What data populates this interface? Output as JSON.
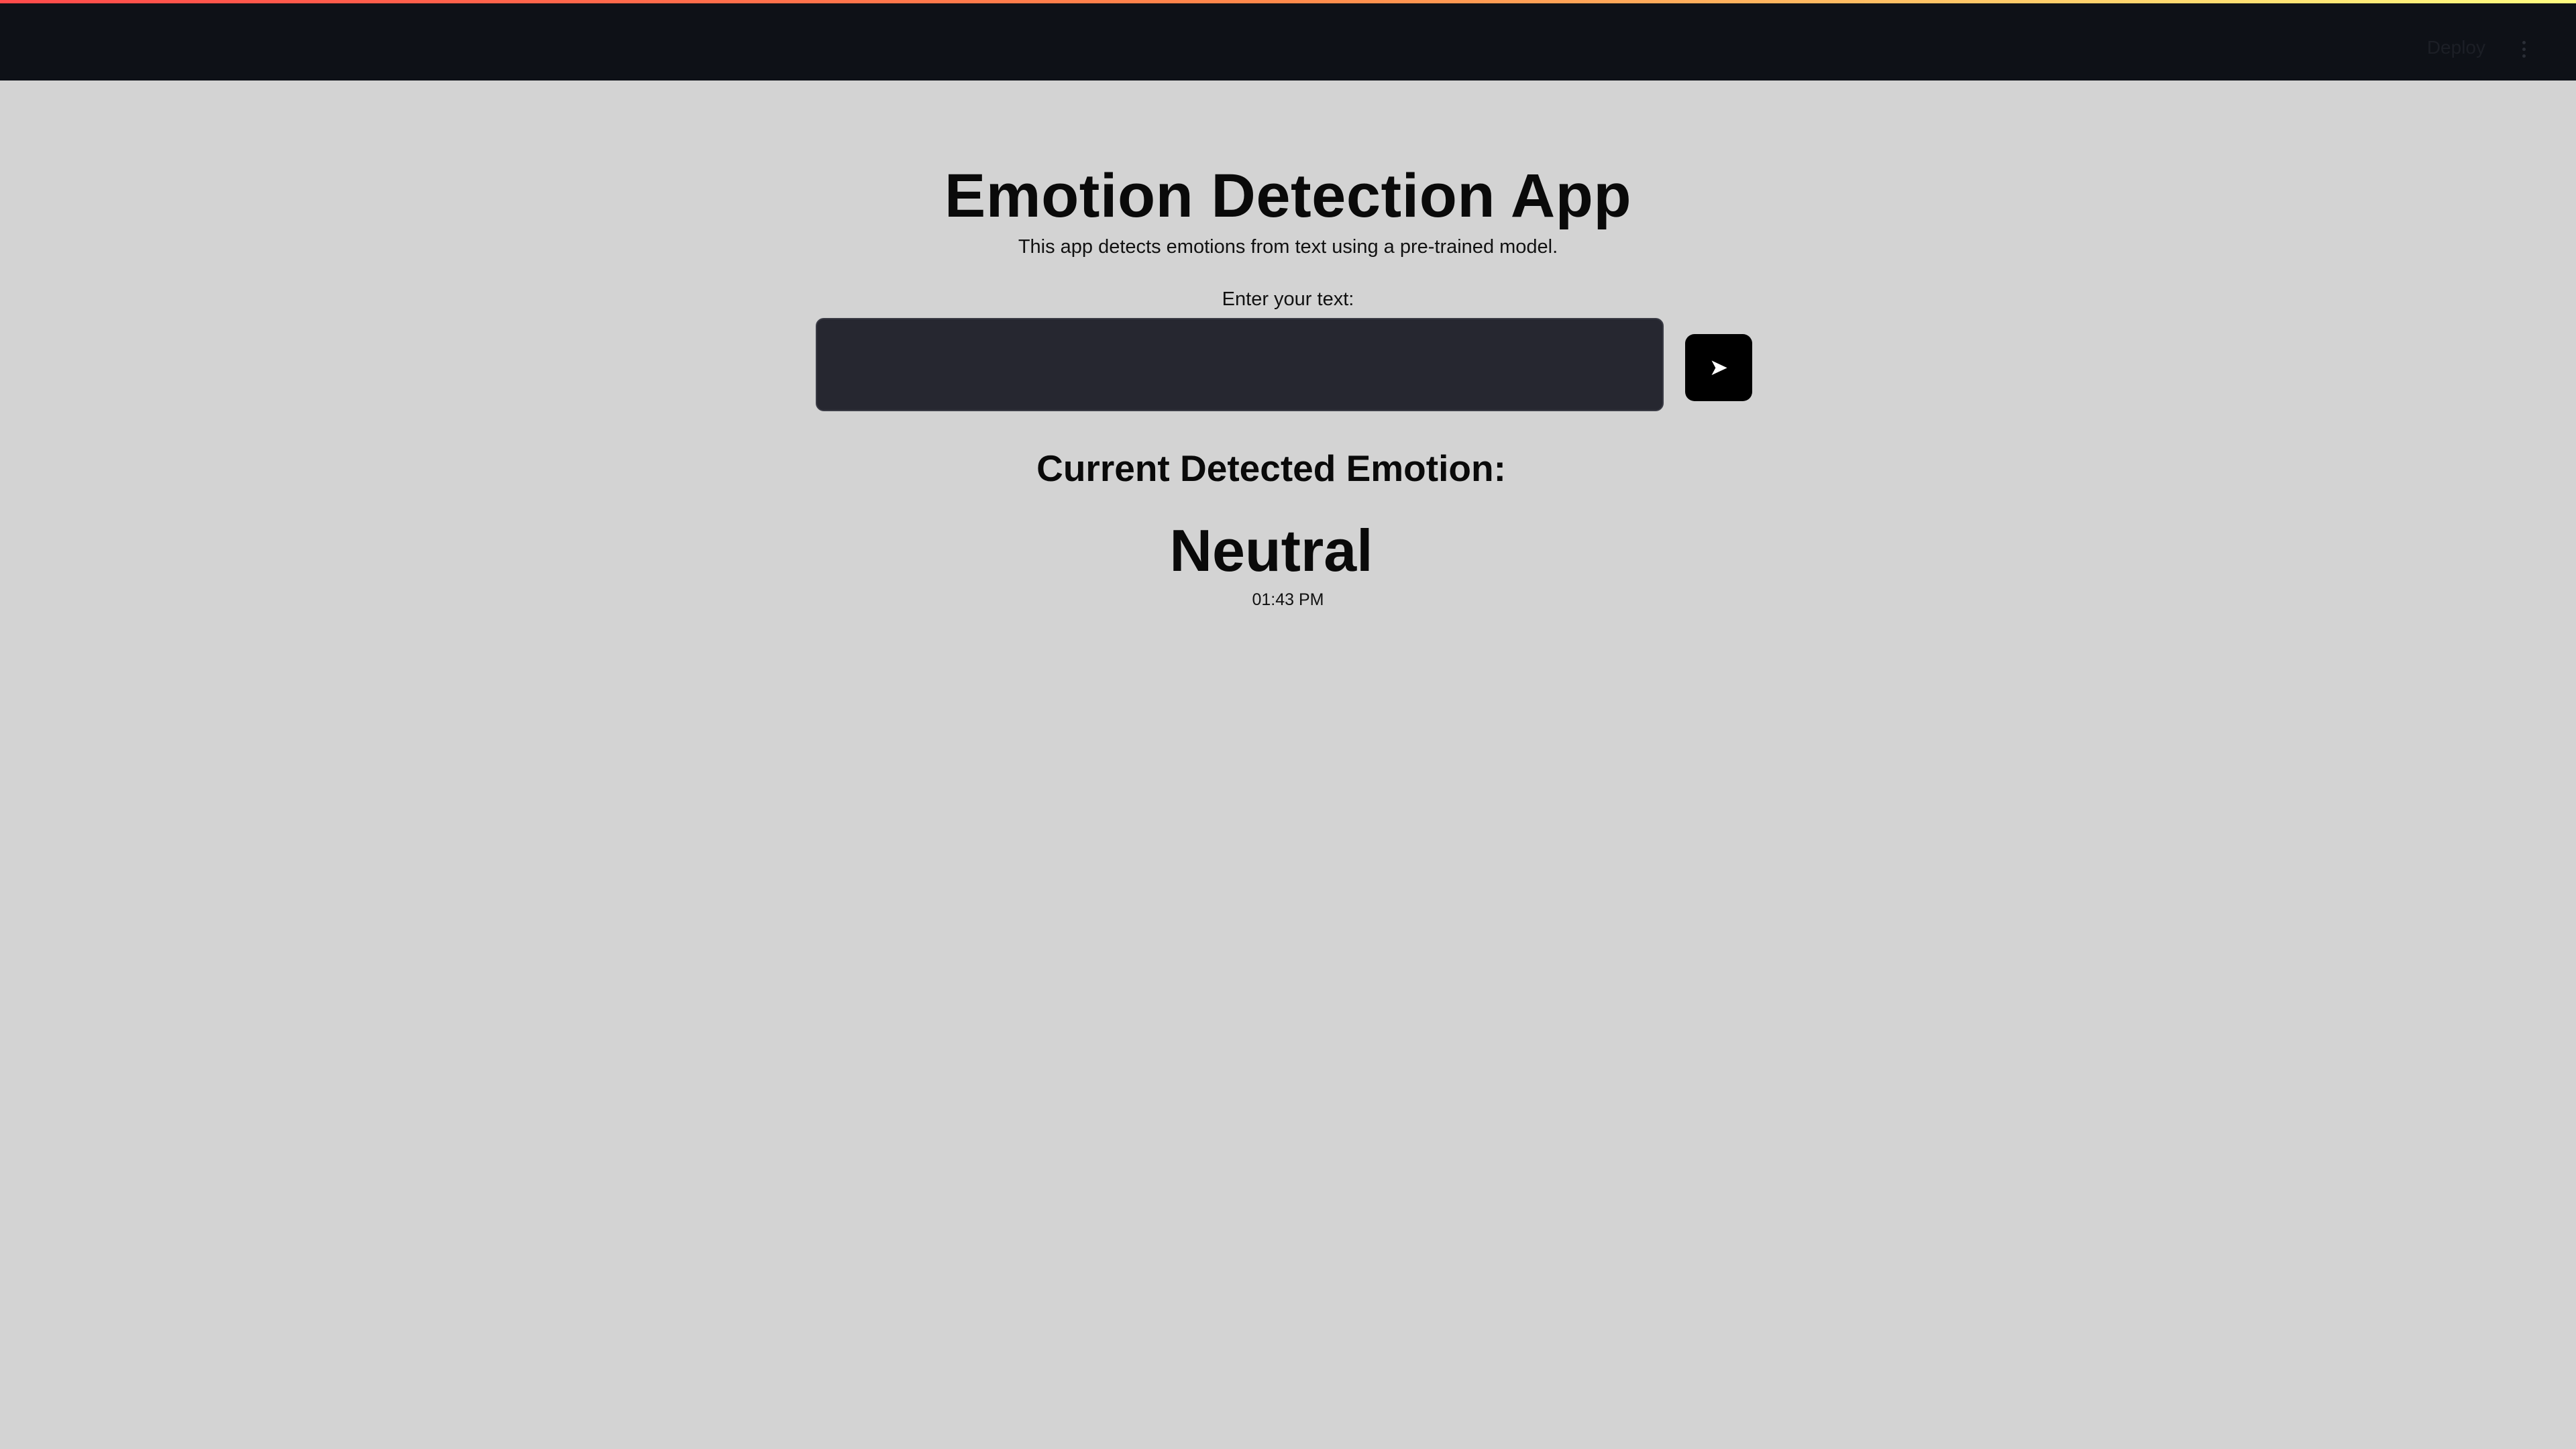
{
  "header": {
    "deploy_label": "Deploy",
    "menu_icon": "vertical-ellipsis-icon"
  },
  "main": {
    "title": "Emotion Detection App",
    "subtitle": "This app detects emotions from text using a pre-trained model.",
    "input_label": "Enter your text:",
    "input_value": "",
    "send_icon": "send-arrow-icon",
    "send_glyph": "➤",
    "emotion_heading": "Current Detected Emotion:",
    "emotion_value": "Neutral",
    "timestamp": "01:43 PM"
  },
  "colors": {
    "background": "#d3d3d3",
    "header": "#0e1117",
    "input_background": "#262730",
    "button": "#000000",
    "accent_gradient_start": "#ff4b4b",
    "accent_gradient_end": "#fffd80"
  }
}
